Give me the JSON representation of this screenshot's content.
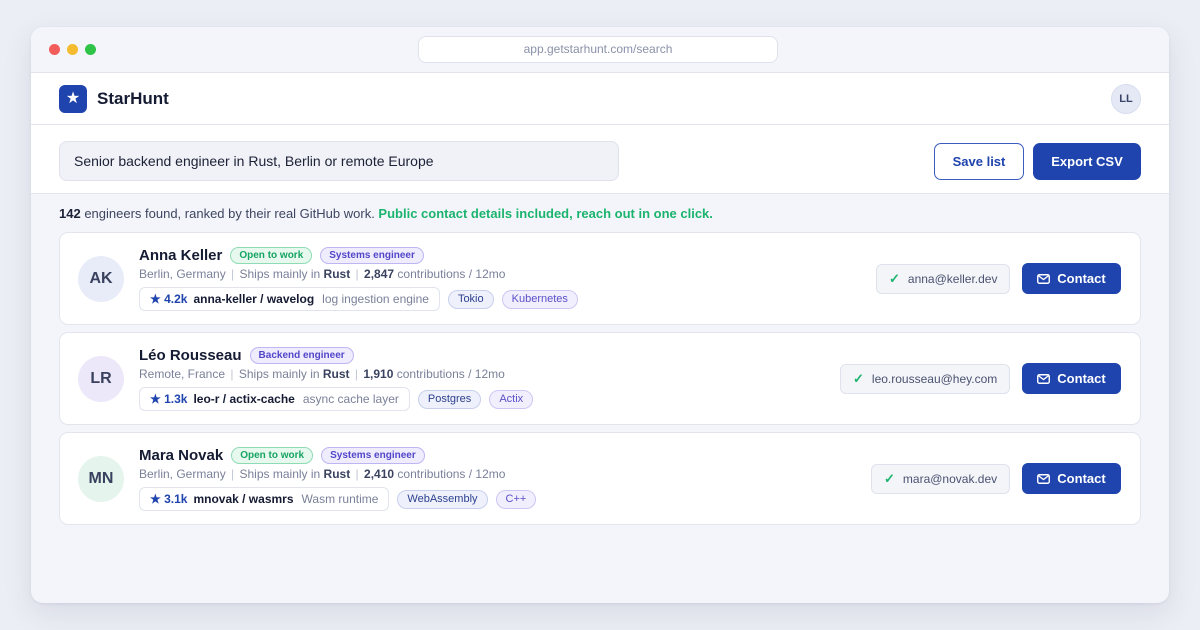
{
  "browser": {
    "url": "app.getstarhunt.com/search"
  },
  "app": {
    "logo_glyph": "★",
    "name": "StarHunt",
    "user_initials": "LL"
  },
  "search": {
    "query": "Senior backend engineer in Rust, Berlin or remote Europe"
  },
  "actions": {
    "save_label": "Save list",
    "export_label": "Export CSV"
  },
  "summary": {
    "count": "142",
    "text": " engineers found, ranked by their real GitHub work. ",
    "highlight": "Public contact details included, reach out in one click."
  },
  "candidates": [
    {
      "initials": "AK",
      "name": "Anna Keller",
      "badges": [
        "Open to work",
        "Systems engineer"
      ],
      "location": "Berlin, Germany",
      "ships_label": "Ships mainly in",
      "language": "Rust",
      "contributions": "2,847",
      "contrib_label": "contributions / 12mo",
      "repo": {
        "stars": "★ 4.2k",
        "name": "anna-keller / wavelog",
        "desc": "log ingestion engine"
      },
      "tags": [
        "Tokio",
        "Kubernetes"
      ],
      "email": "anna@keller.dev",
      "contact_label": "Contact"
    },
    {
      "initials": "LR",
      "name": "Léo Rousseau",
      "badges": [
        "Backend engineer"
      ],
      "location": "Remote, France",
      "ships_label": "Ships mainly in",
      "language": "Rust",
      "contributions": "1,910",
      "contrib_label": "contributions / 12mo",
      "repo": {
        "stars": "★ 1.3k",
        "name": "leo-r / actix-cache",
        "desc": "async cache layer"
      },
      "tags": [
        "Postgres",
        "Actix"
      ],
      "email": "leo.rousseau@hey.com",
      "contact_label": "Contact"
    },
    {
      "initials": "MN",
      "name": "Mara Novak",
      "badges": [
        "Open to work",
        "Systems engineer"
      ],
      "location": "Berlin, Germany",
      "ships_label": "Ships mainly in",
      "language": "Rust",
      "contributions": "2,410",
      "contrib_label": "contributions / 12mo",
      "repo": {
        "stars": "★ 3.1k",
        "name": "mnovak / wasmrs",
        "desc": "Wasm runtime"
      },
      "tags": [
        "WebAssembly",
        "C++"
      ],
      "email": "mara@novak.dev",
      "contact_label": "Contact"
    }
  ],
  "colors": {
    "primary": "#1f44ad",
    "success": "#1bb46e",
    "accent_purple": "#5346c9"
  }
}
